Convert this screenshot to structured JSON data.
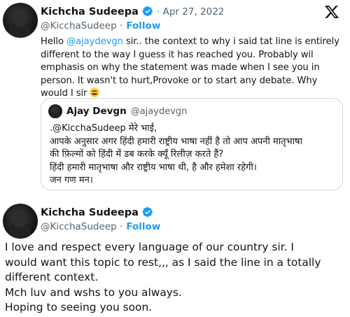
{
  "tweet1": {
    "author_name": "Kichcha Sudeepa",
    "date": "· Apr 27, 2022",
    "handle": "@KicchaSudeep ·",
    "follow_label": "Follow",
    "body_prefix": "Hello ",
    "mention": "@ajaydevgn",
    "body_rest": " sir.. the context to why i said tat line is entirely different to the way I guess it has reached you. Probably wil emphasis on why the statement was made when I see you in person. It wasn't to hurt,Provoke or to start any debate. Why would I sir ",
    "emoji": "grinning-face-emoji"
  },
  "quote": {
    "author_name": "Ajay Devgn",
    "handle": "@ajaydevgn",
    "lines": [
      ".@KicchaSudeep मेरे भाई,",
      "आपके अनुसार अगर हिंदी हमारी राष्ट्रीय भाषा नहीं है तो आप अपनी मातृभाषा",
      "की फ़िल्मों को हिंदी में डब करके क्यूँ रिलीज़ करते हैं?",
      "हिंदी हमारी मातृभाषा और राष्ट्रीय भाषा थी, है और हमेशा रहेगी।",
      "जन गण मन।"
    ]
  },
  "tweet2": {
    "author_name": "Kichcha Sudeepa",
    "handle": "@KicchaSudeep ·",
    "follow_label": "Follow",
    "lines": [
      "I love and respect every language of our country sir. I",
      "would want this topic to rest,,, as I said the line in a totally",
      "different context.",
      "Mch luv and wshs to you always.",
      "Hoping to seeing you soon."
    ]
  },
  "colors": {
    "accent": "#1d9bf0",
    "muted": "#536471",
    "text": "#0f1419",
    "border": "#cfd9de"
  },
  "icons": {
    "platform": "x-logo-icon",
    "verified": "verified-badge-icon"
  }
}
